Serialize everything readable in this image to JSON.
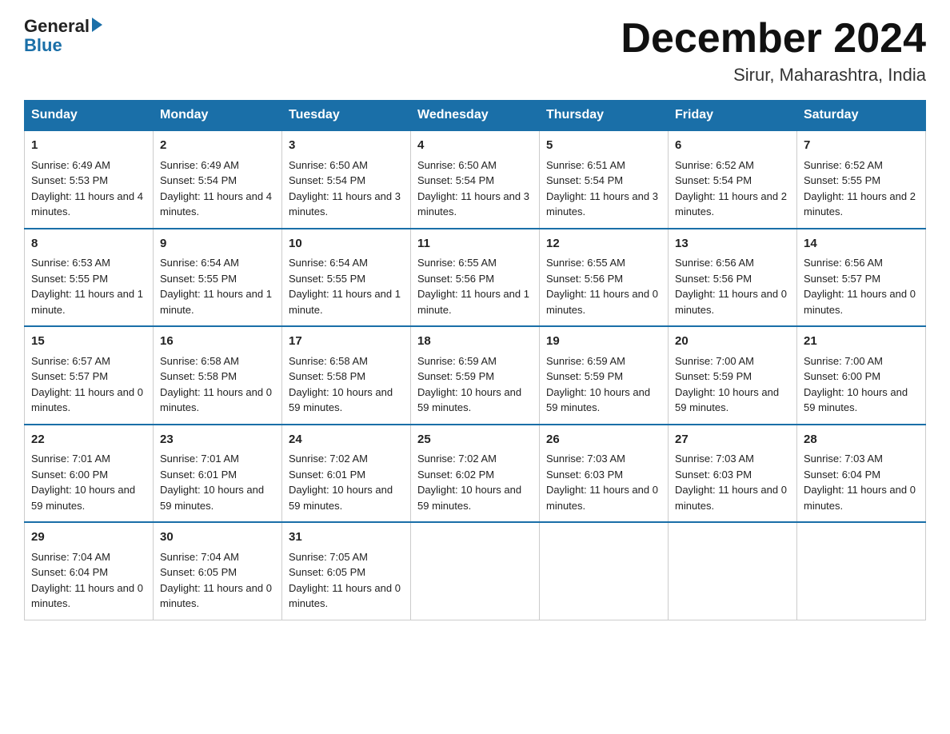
{
  "header": {
    "logo_general": "General",
    "logo_blue": "Blue",
    "month_title": "December 2024",
    "subtitle": "Sirur, Maharashtra, India"
  },
  "days_of_week": [
    "Sunday",
    "Monday",
    "Tuesday",
    "Wednesday",
    "Thursday",
    "Friday",
    "Saturday"
  ],
  "weeks": [
    [
      {
        "day": 1,
        "sunrise": "6:49 AM",
        "sunset": "5:53 PM",
        "daylight": "11 hours and 4 minutes."
      },
      {
        "day": 2,
        "sunrise": "6:49 AM",
        "sunset": "5:54 PM",
        "daylight": "11 hours and 4 minutes."
      },
      {
        "day": 3,
        "sunrise": "6:50 AM",
        "sunset": "5:54 PM",
        "daylight": "11 hours and 3 minutes."
      },
      {
        "day": 4,
        "sunrise": "6:50 AM",
        "sunset": "5:54 PM",
        "daylight": "11 hours and 3 minutes."
      },
      {
        "day": 5,
        "sunrise": "6:51 AM",
        "sunset": "5:54 PM",
        "daylight": "11 hours and 3 minutes."
      },
      {
        "day": 6,
        "sunrise": "6:52 AM",
        "sunset": "5:54 PM",
        "daylight": "11 hours and 2 minutes."
      },
      {
        "day": 7,
        "sunrise": "6:52 AM",
        "sunset": "5:55 PM",
        "daylight": "11 hours and 2 minutes."
      }
    ],
    [
      {
        "day": 8,
        "sunrise": "6:53 AM",
        "sunset": "5:55 PM",
        "daylight": "11 hours and 1 minute."
      },
      {
        "day": 9,
        "sunrise": "6:54 AM",
        "sunset": "5:55 PM",
        "daylight": "11 hours and 1 minute."
      },
      {
        "day": 10,
        "sunrise": "6:54 AM",
        "sunset": "5:55 PM",
        "daylight": "11 hours and 1 minute."
      },
      {
        "day": 11,
        "sunrise": "6:55 AM",
        "sunset": "5:56 PM",
        "daylight": "11 hours and 1 minute."
      },
      {
        "day": 12,
        "sunrise": "6:55 AM",
        "sunset": "5:56 PM",
        "daylight": "11 hours and 0 minutes."
      },
      {
        "day": 13,
        "sunrise": "6:56 AM",
        "sunset": "5:56 PM",
        "daylight": "11 hours and 0 minutes."
      },
      {
        "day": 14,
        "sunrise": "6:56 AM",
        "sunset": "5:57 PM",
        "daylight": "11 hours and 0 minutes."
      }
    ],
    [
      {
        "day": 15,
        "sunrise": "6:57 AM",
        "sunset": "5:57 PM",
        "daylight": "11 hours and 0 minutes."
      },
      {
        "day": 16,
        "sunrise": "6:58 AM",
        "sunset": "5:58 PM",
        "daylight": "11 hours and 0 minutes."
      },
      {
        "day": 17,
        "sunrise": "6:58 AM",
        "sunset": "5:58 PM",
        "daylight": "10 hours and 59 minutes."
      },
      {
        "day": 18,
        "sunrise": "6:59 AM",
        "sunset": "5:59 PM",
        "daylight": "10 hours and 59 minutes."
      },
      {
        "day": 19,
        "sunrise": "6:59 AM",
        "sunset": "5:59 PM",
        "daylight": "10 hours and 59 minutes."
      },
      {
        "day": 20,
        "sunrise": "7:00 AM",
        "sunset": "5:59 PM",
        "daylight": "10 hours and 59 minutes."
      },
      {
        "day": 21,
        "sunrise": "7:00 AM",
        "sunset": "6:00 PM",
        "daylight": "10 hours and 59 minutes."
      }
    ],
    [
      {
        "day": 22,
        "sunrise": "7:01 AM",
        "sunset": "6:00 PM",
        "daylight": "10 hours and 59 minutes."
      },
      {
        "day": 23,
        "sunrise": "7:01 AM",
        "sunset": "6:01 PM",
        "daylight": "10 hours and 59 minutes."
      },
      {
        "day": 24,
        "sunrise": "7:02 AM",
        "sunset": "6:01 PM",
        "daylight": "10 hours and 59 minutes."
      },
      {
        "day": 25,
        "sunrise": "7:02 AM",
        "sunset": "6:02 PM",
        "daylight": "10 hours and 59 minutes."
      },
      {
        "day": 26,
        "sunrise": "7:03 AM",
        "sunset": "6:03 PM",
        "daylight": "11 hours and 0 minutes."
      },
      {
        "day": 27,
        "sunrise": "7:03 AM",
        "sunset": "6:03 PM",
        "daylight": "11 hours and 0 minutes."
      },
      {
        "day": 28,
        "sunrise": "7:03 AM",
        "sunset": "6:04 PM",
        "daylight": "11 hours and 0 minutes."
      }
    ],
    [
      {
        "day": 29,
        "sunrise": "7:04 AM",
        "sunset": "6:04 PM",
        "daylight": "11 hours and 0 minutes."
      },
      {
        "day": 30,
        "sunrise": "7:04 AM",
        "sunset": "6:05 PM",
        "daylight": "11 hours and 0 minutes."
      },
      {
        "day": 31,
        "sunrise": "7:05 AM",
        "sunset": "6:05 PM",
        "daylight": "11 hours and 0 minutes."
      },
      null,
      null,
      null,
      null
    ]
  ]
}
